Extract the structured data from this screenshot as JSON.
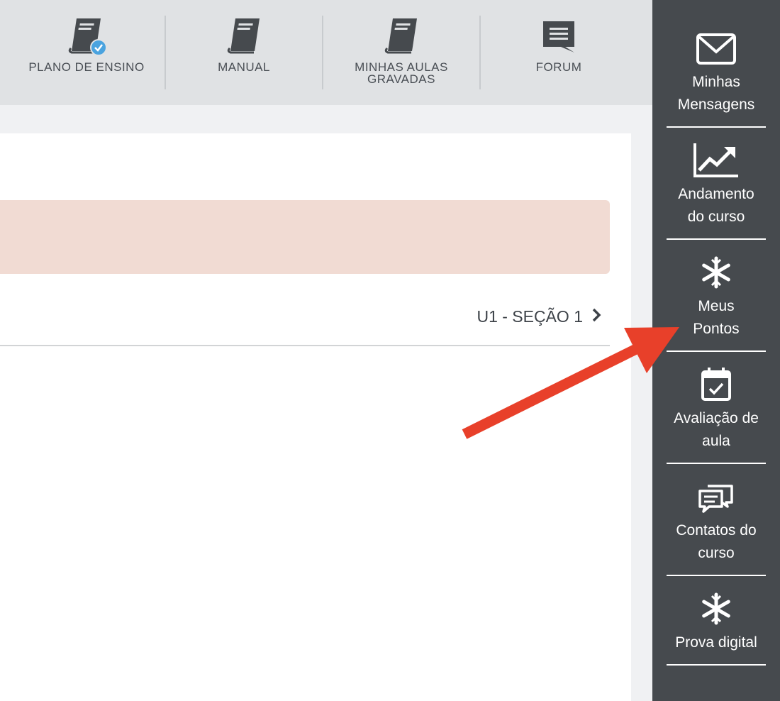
{
  "topnav": {
    "items": [
      {
        "label": "PLANO DE ENSINO",
        "icon": "book-check-icon"
      },
      {
        "label": "MANUAL",
        "icon": "book-icon"
      },
      {
        "label": "MINHAS AULAS",
        "label2": "GRAVADAS",
        "icon": "book-icon"
      },
      {
        "label": "FORUM",
        "icon": "chat-bubble-icon"
      }
    ]
  },
  "content": {
    "section_link": "U1 - SEÇÃO 1"
  },
  "sidebar": {
    "items": [
      {
        "line1": "Minhas",
        "line2": "Mensagens",
        "icon": "envelope-icon"
      },
      {
        "line1": "Andamento",
        "line2": "do curso",
        "icon": "chart-icon"
      },
      {
        "line1": "Meus",
        "line2": "Pontos",
        "icon": "asterisk-icon"
      },
      {
        "line1": "Avaliação de",
        "line2": "aula",
        "icon": "calendar-check-icon"
      },
      {
        "line1": "Contatos do",
        "line2": "curso",
        "icon": "chat-icon"
      },
      {
        "line1": "Prova digital",
        "icon": "asterisk-icon"
      }
    ]
  },
  "colors": {
    "sidebar_bg": "#464a4e",
    "topbar_bg": "#e0e2e4",
    "alert_bg": "#f1dbd3",
    "arrow": "#e8402a",
    "check_badge": "#4aa3df"
  }
}
